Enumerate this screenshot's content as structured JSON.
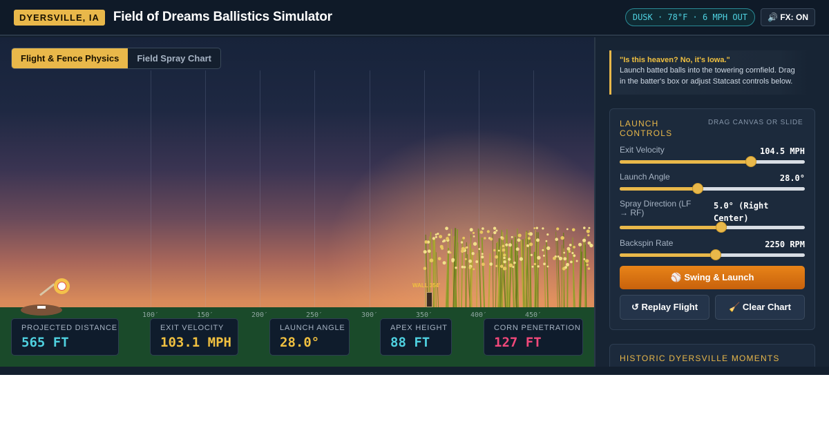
{
  "header": {
    "location": "DYERSVILLE, IA",
    "title": "Field of Dreams Ballistics Simulator",
    "weather": "DUSK · 78°F · 6 MPH OUT",
    "fx_label": "FX: ON",
    "fx_icon": "speaker-icon"
  },
  "tabs": [
    {
      "label": "Flight & Fence Physics",
      "active": true
    },
    {
      "label": "Field Spray Chart",
      "active": false
    }
  ],
  "field": {
    "distance_ticks": [
      "100′",
      "150′",
      "200′",
      "250′",
      "300′",
      "350′",
      "400′",
      "450′"
    ],
    "wall_label": "WALL 354′"
  },
  "stats": [
    {
      "label": "PROJECTED DISTANCE",
      "value": "565 FT",
      "color": "#4fd1e0"
    },
    {
      "label": "EXIT VELOCITY",
      "value": "103.1 MPH",
      "color": "#f0c040"
    },
    {
      "label": "LAUNCH ANGLE",
      "value": "28.0°",
      "color": "#f0c040"
    },
    {
      "label": "APEX HEIGHT",
      "value": "88 FT",
      "color": "#4fd1e0"
    },
    {
      "label": "CORN PENETRATION",
      "value": "127 FT",
      "color": "#f0487a"
    }
  ],
  "quote": {
    "title": "\"Is this heaven? No, it's Iowa.\"",
    "body": "Launch batted balls into the towering cornfield. Drag in the batter's box or adjust Statcast controls below."
  },
  "controls": {
    "title": "LAUNCH CONTROLS",
    "hint": "DRAG CANVAS OR SLIDE",
    "sliders": [
      {
        "label": "Exit Velocity",
        "value": "104.5 MPH",
        "fraction": 0.71
      },
      {
        "label": "Launch Angle",
        "value": "28.0°",
        "fraction": 0.42
      },
      {
        "label": "Spray Direction (LF → RF)",
        "value": "5.0° (Right Center)",
        "fraction": 0.55
      },
      {
        "label": "Backspin Rate",
        "value": "2250 RPM",
        "fraction": 0.52
      }
    ],
    "launch_label": "⚾ Swing & Launch",
    "replay_label": "↺ Replay Flight",
    "clear_label": "🧹 Clear Chart"
  },
  "history": {
    "title": "HISTORIC DYERSVILLE MOMENTS"
  },
  "colors": {
    "accent": "#e9b84a",
    "cyan": "#4fd1e0",
    "pink": "#f0487a",
    "orange": "#e07a14"
  }
}
